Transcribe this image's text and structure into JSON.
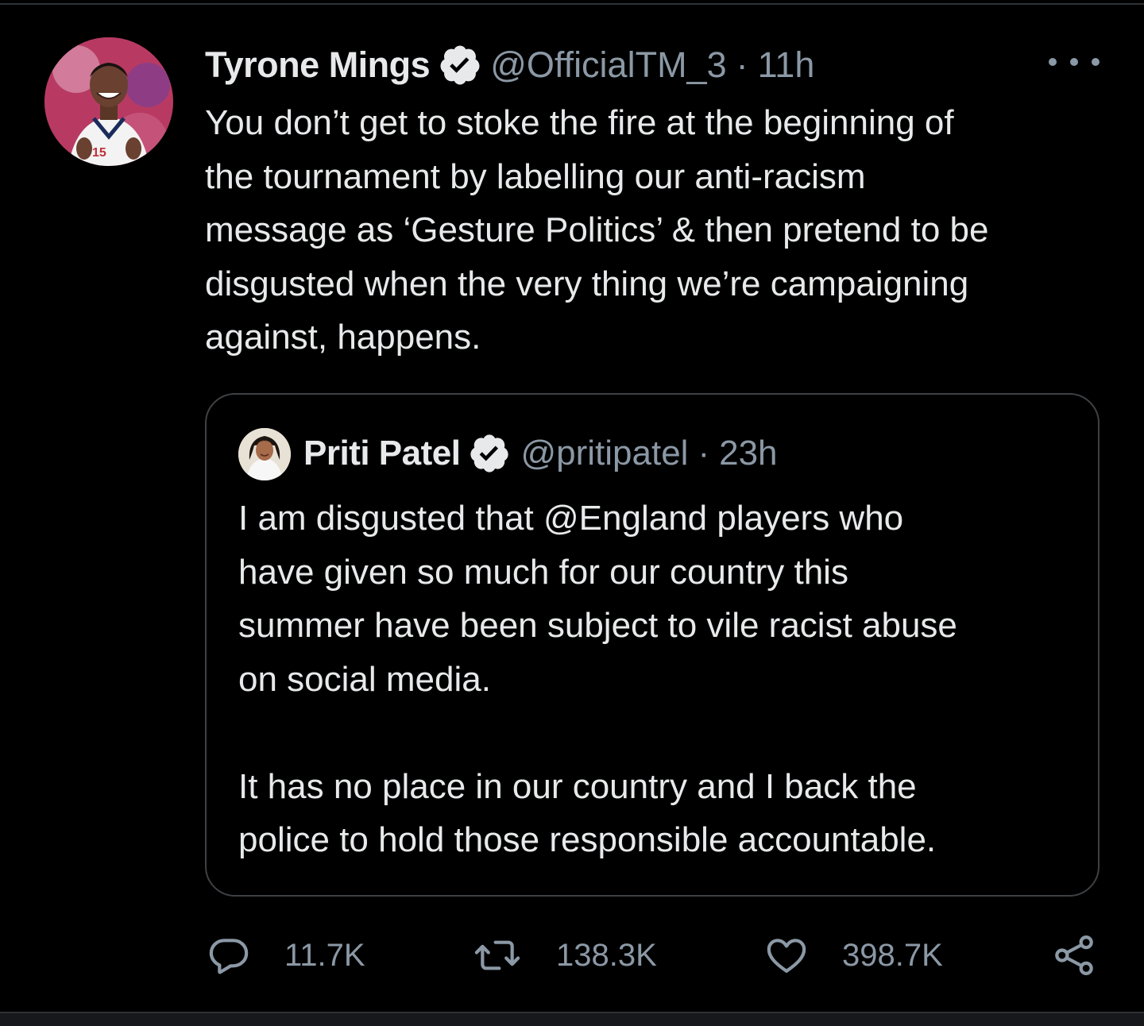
{
  "tweet": {
    "author_name": "Tyrone Mings",
    "author_handle": "@OfficialTM_3",
    "separator": "·",
    "time": "11h",
    "text_lines": [
      "You don’t get to stoke the fire at the beginning of",
      "the tournament by labelling our anti-racism",
      "message as ‘Gesture Politics’ & then pretend to be",
      "disgusted when the very thing we’re campaigning",
      "against, happens."
    ]
  },
  "quoted_tweet": {
    "author_name": "Priti Patel",
    "author_handle": "@pritipatel",
    "separator": "·",
    "time": "23h",
    "paragraph1_lines": [
      "I am disgusted that @England players who",
      "have given so much for our country this",
      "summer have been subject to vile racist abuse",
      "on social media."
    ],
    "paragraph2_lines": [
      "It has no place in our country and I back the",
      "police to hold those responsible accountable."
    ]
  },
  "actions": {
    "reply_count": "11.7K",
    "retweet_count": "138.3K",
    "like_count": "398.7K"
  },
  "icons": {
    "verified": "verified-badge-icon",
    "more": "more-dots-icon",
    "reply": "reply-bubble-icon",
    "retweet": "retweet-arrows-icon",
    "like": "heart-icon",
    "share": "share-icon"
  },
  "colors": {
    "background": "#000000",
    "primary_text": "#e7e9ea",
    "secondary_text": "#8b98a5",
    "border": "#3e4144"
  }
}
